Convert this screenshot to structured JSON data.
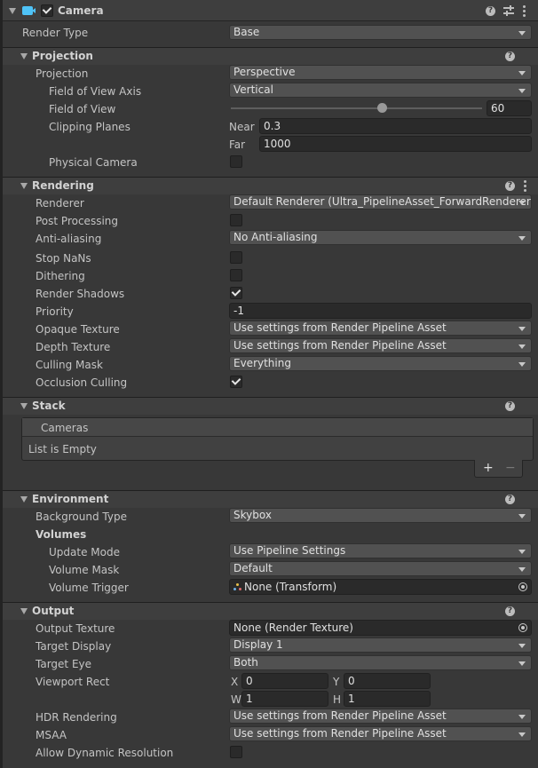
{
  "component": {
    "title": "Camera",
    "enabled": true
  },
  "render_type": {
    "label": "Render Type",
    "value": "Base"
  },
  "projection": {
    "header": "Projection",
    "projection": {
      "label": "Projection",
      "value": "Perspective"
    },
    "fov_axis": {
      "label": "Field of View Axis",
      "value": "Vertical"
    },
    "fov": {
      "label": "Field of View",
      "value": "60",
      "slider_fraction": 0.6
    },
    "clipping": {
      "label": "Clipping Planes",
      "near_label": "Near",
      "near": "0.3",
      "far_label": "Far",
      "far": "1000"
    },
    "physical_camera": {
      "label": "Physical Camera",
      "checked": false
    }
  },
  "rendering": {
    "header": "Rendering",
    "renderer": {
      "label": "Renderer",
      "value": "Default Renderer (Ultra_PipelineAsset_ForwardRenderer)"
    },
    "post_processing": {
      "label": "Post Processing",
      "checked": false
    },
    "anti_aliasing": {
      "label": "Anti-aliasing",
      "value": "No Anti-aliasing"
    },
    "stop_nans": {
      "label": "Stop NaNs",
      "checked": false
    },
    "dithering": {
      "label": "Dithering",
      "checked": false
    },
    "render_shadows": {
      "label": "Render Shadows",
      "checked": true
    },
    "priority": {
      "label": "Priority",
      "value": "-1"
    },
    "opaque_texture": {
      "label": "Opaque Texture",
      "value": "Use settings from Render Pipeline Asset"
    },
    "depth_texture": {
      "label": "Depth Texture",
      "value": "Use settings from Render Pipeline Asset"
    },
    "culling_mask": {
      "label": "Culling Mask",
      "value": "Everything"
    },
    "occlusion_culling": {
      "label": "Occlusion Culling",
      "checked": true
    }
  },
  "stack": {
    "header": "Stack",
    "list_header": "Cameras",
    "empty_text": "List is Empty",
    "add": "+",
    "remove": "−"
  },
  "environment": {
    "header": "Environment",
    "background_type": {
      "label": "Background Type",
      "value": "Skybox"
    },
    "volumes_label": "Volumes",
    "update_mode": {
      "label": "Update Mode",
      "value": "Use Pipeline Settings"
    },
    "volume_mask": {
      "label": "Volume Mask",
      "value": "Default"
    },
    "volume_trigger": {
      "label": "Volume Trigger",
      "value": "None (Transform)"
    }
  },
  "output": {
    "header": "Output",
    "output_texture": {
      "label": "Output Texture",
      "value": "None (Render Texture)"
    },
    "target_display": {
      "label": "Target Display",
      "value": "Display 1"
    },
    "target_eye": {
      "label": "Target Eye",
      "value": "Both"
    },
    "viewport": {
      "label": "Viewport Rect",
      "x_label": "X",
      "x": "0",
      "y_label": "Y",
      "y": "0",
      "w_label": "W",
      "w": "1",
      "h_label": "H",
      "h": "1"
    },
    "hdr": {
      "label": "HDR Rendering",
      "value": "Use settings from Render Pipeline Asset"
    },
    "msaa": {
      "label": "MSAA",
      "value": "Use settings from Render Pipeline Asset"
    },
    "dynamic_resolution": {
      "label": "Allow Dynamic Resolution",
      "checked": false
    }
  },
  "colors": {
    "accent": "#4fc3f7",
    "background": "#383838",
    "header": "#3e3e3e"
  }
}
